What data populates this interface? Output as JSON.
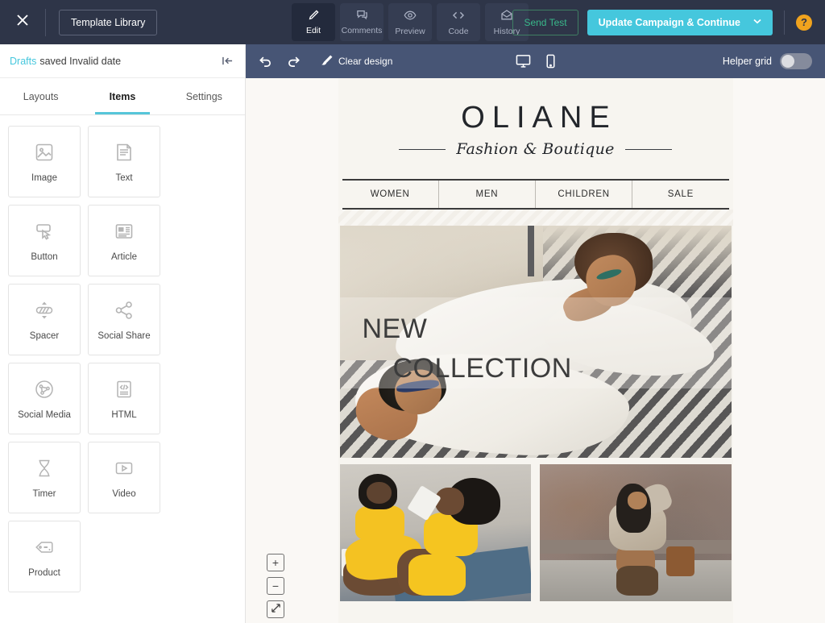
{
  "header": {
    "close_icon": "close-icon",
    "template_library_label": "Template Library",
    "mode_tabs": [
      {
        "label": "Edit",
        "icon": "pencil-icon",
        "active": true
      },
      {
        "label": "Comments",
        "icon": "comment-icon",
        "active": false
      },
      {
        "label": "Preview",
        "icon": "eye-icon",
        "active": false
      },
      {
        "label": "Code",
        "icon": "code-icon",
        "active": false
      },
      {
        "label": "History",
        "icon": "envelope-icon",
        "active": false
      }
    ],
    "send_test_label": "Send Test",
    "update_label": "Update Campaign & Continue",
    "update_chevron": "⌄",
    "help_label": "?"
  },
  "sidebar": {
    "drafts_link": "Drafts",
    "drafts_status": "saved Invalid date",
    "collapse_icon": "collapse-panel-icon",
    "tabs": [
      {
        "label": "Layouts",
        "active": false
      },
      {
        "label": "Items",
        "active": true
      },
      {
        "label": "Settings",
        "active": false
      }
    ],
    "items": [
      {
        "label": "Image",
        "icon": "image-icon"
      },
      {
        "label": "Text",
        "icon": "text-document-icon"
      },
      {
        "label": "Button",
        "icon": "button-click-icon"
      },
      {
        "label": "Article",
        "icon": "article-icon"
      },
      {
        "label": "Spacer",
        "icon": "spacer-icon"
      },
      {
        "label": "Social Share",
        "icon": "share-icon"
      },
      {
        "label": "Social Media",
        "icon": "social-network-icon"
      },
      {
        "label": "HTML",
        "icon": "html-code-icon"
      },
      {
        "label": "Timer",
        "icon": "hourglass-icon"
      },
      {
        "label": "Video",
        "icon": "video-play-icon"
      },
      {
        "label": "Product",
        "icon": "price-tag-icon"
      }
    ]
  },
  "toolbar": {
    "undo_icon": "undo-icon",
    "redo_icon": "redo-icon",
    "clear_design_label": "Clear design",
    "desktop_icon": "desktop-icon",
    "mobile_icon": "mobile-icon",
    "helper_grid_label": "Helper grid",
    "helper_grid_on": false
  },
  "email": {
    "logo": {
      "wordmark": "OLIANE",
      "tagline": "Fashion & Boutique"
    },
    "nav": [
      "WOMEN",
      "MEN",
      "CHILDREN",
      "SALE"
    ],
    "hero": {
      "line1": "NEW",
      "line2": "COLLECTION"
    }
  },
  "zoom_controls": {
    "zoom_in": "+",
    "zoom_out": "−",
    "fit_icon": "expand-icon"
  },
  "colors": {
    "header_bg": "#2e3548",
    "toolbar_bg": "#475575",
    "accent_teal": "#45c7dd",
    "send_test_green": "#39b88a",
    "help_orange": "#f0a31e",
    "canvas_bg": "#faf8f5",
    "email_bg": "#f7f5f0"
  }
}
